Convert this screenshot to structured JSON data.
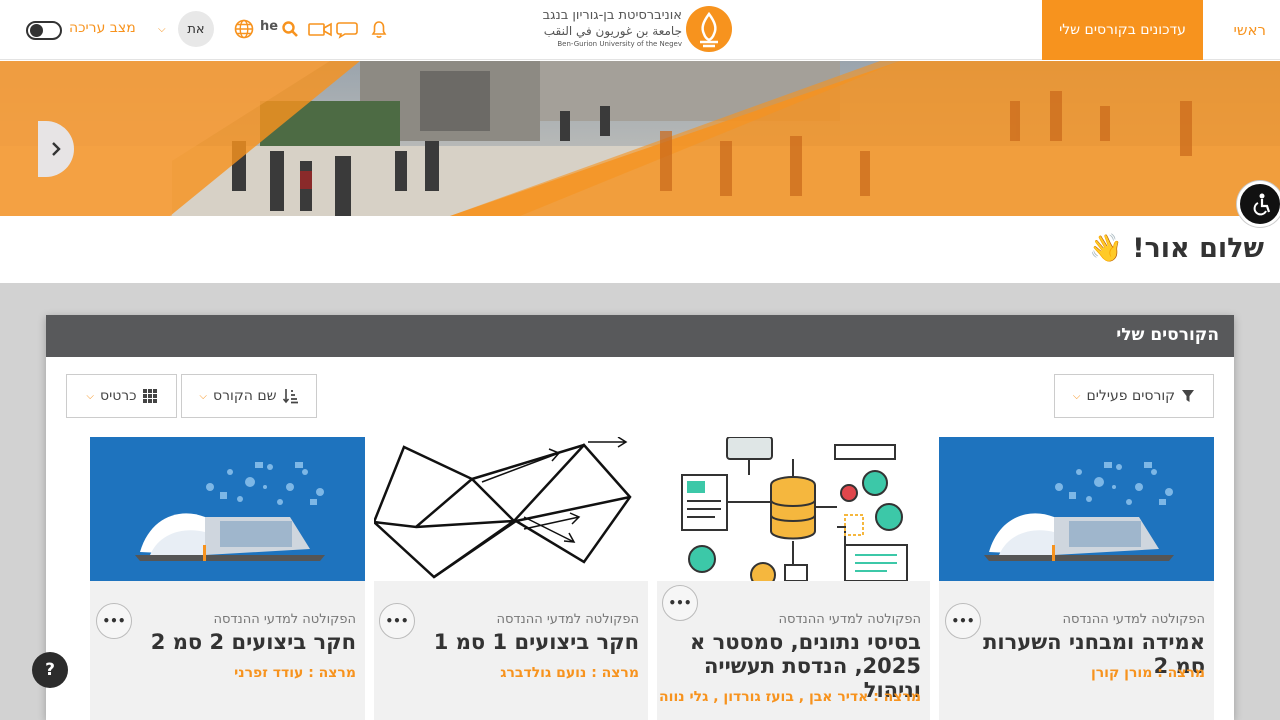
{
  "nav": {
    "home_label": "ראשי",
    "updates_label": "עדכונים בקורסים שלי",
    "lang_code": "he",
    "avatar_initials": "את",
    "edit_mode_label": "מצב עריכה"
  },
  "logo": {
    "line1": "אוניברסיטת בן-גוריון בנגב",
    "line2": "جامعة بن غوريون في النقب",
    "line3": "Ben-Gurion University of the Negev"
  },
  "greeting": "שלום אור! 👋",
  "panel": {
    "title": "הקורסים שלי",
    "filter_label": "קורסים פעילים",
    "sort_label": "שם הקורס",
    "view_label": "כרטיס"
  },
  "courses": [
    {
      "faculty": "הפקולטה למדעי ההנדסה",
      "title": "אמידה ומבחני השערות סמ 2",
      "teacher": "מרצה : מורן קורן",
      "image": "book-laptop"
    },
    {
      "faculty": "הפקולטה למדעי ההנדסה",
      "title": "בסיסי נתונים, סמסטר א 2025, הנדסת תעשייה וניהול",
      "teacher": "מרצה : אדיר אבן , בועז גורדון , גלי נווה",
      "image": "database-diagram"
    },
    {
      "faculty": "הפקולטה למדעי ההנדסה",
      "title": "חקר ביצועים 1 סמ 1",
      "teacher": "מרצה : נועם גולדברג",
      "image": "polygon-graph"
    },
    {
      "faculty": "הפקולטה למדעי ההנדסה",
      "title": "חקר ביצועים 2 סמ 2",
      "teacher": "מרצה : עודד זפרני",
      "image": "book-laptop"
    }
  ],
  "help_label": "?",
  "colors": {
    "accent": "#f7931e",
    "panel_header": "#58595b",
    "card_image_blue": "#1e73be"
  }
}
